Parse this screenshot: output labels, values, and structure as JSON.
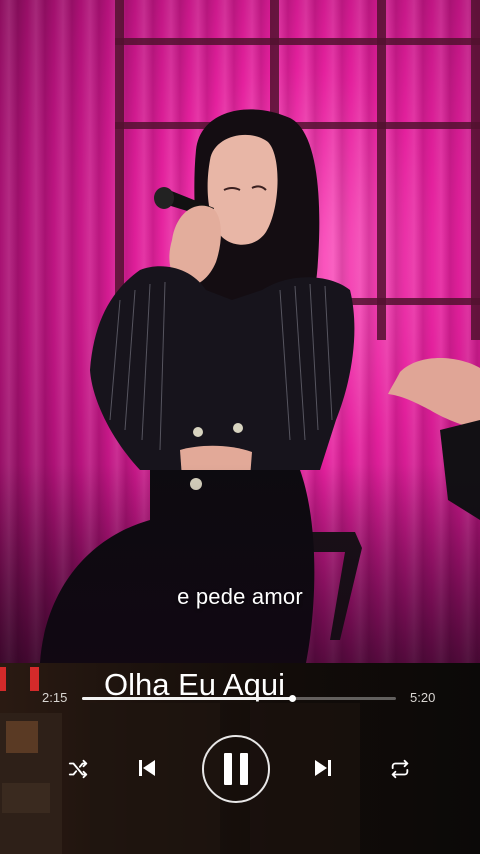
{
  "video": {
    "subtitle": "e pede amor"
  },
  "player": {
    "song_title": "Olha Eu Aqui",
    "time_elapsed": "2:15",
    "time_total": "5:20",
    "progress_fraction": 0.67,
    "controls": {
      "shuffle_icon": "shuffle-icon",
      "previous_icon": "skip-previous-icon",
      "play_pause_icon": "pause-icon",
      "next_icon": "skip-next-icon",
      "repeat_icon": "repeat-icon"
    }
  },
  "colors": {
    "stage_pink": "#e4209d",
    "progress_fill": "#f2f2f2",
    "icon": "#ffffff",
    "accent_red": "#d42a2a"
  }
}
